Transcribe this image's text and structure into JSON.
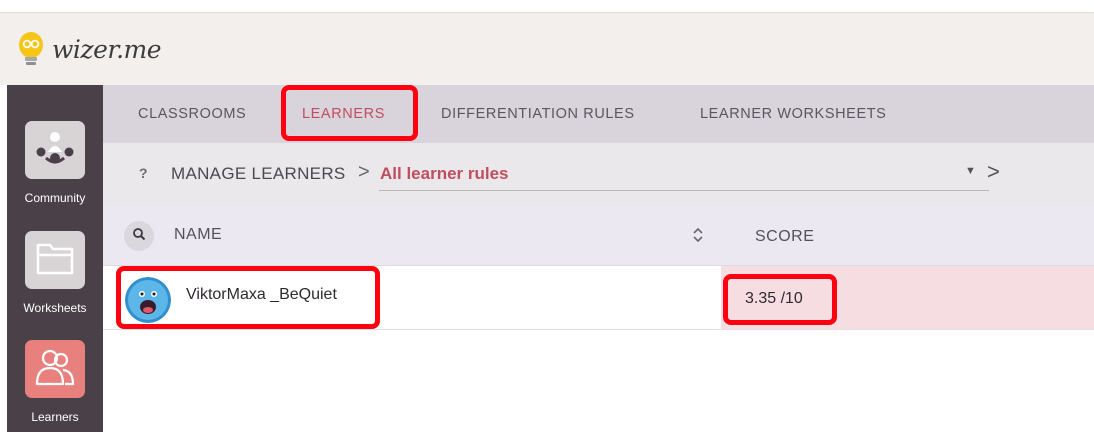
{
  "app": {
    "logo_text": "wizer.me"
  },
  "sidebar": {
    "items": [
      {
        "label": "Community",
        "icon": "community-icon"
      },
      {
        "label": "Worksheets",
        "icon": "folder-icon"
      },
      {
        "label": "Learners",
        "icon": "learners-icon",
        "active": true
      }
    ]
  },
  "tabs": [
    {
      "label": "CLASSROOMS"
    },
    {
      "label": "LEARNERS",
      "active": true
    },
    {
      "label": "DIFFERENTIATION RULES"
    },
    {
      "label": "LEARNER WORKSHEETS"
    }
  ],
  "breadcrumb": {
    "help": "?",
    "parent": "MANAGE LEARNERS",
    "separator": ">",
    "current": "All learner rules",
    "dropdown_icon": "▼",
    "next_icon": ">"
  },
  "table": {
    "columns": {
      "name": "NAME",
      "score": "SCORE"
    },
    "rows": [
      {
        "name": "ViktorMaxa _BeQuiet",
        "score": "3.35 /10"
      }
    ]
  },
  "colors": {
    "accent": "#c24d60",
    "sidebar_bg": "#4a4148",
    "highlight": "#ff0010",
    "score_row_bg": "#f6dde2"
  }
}
